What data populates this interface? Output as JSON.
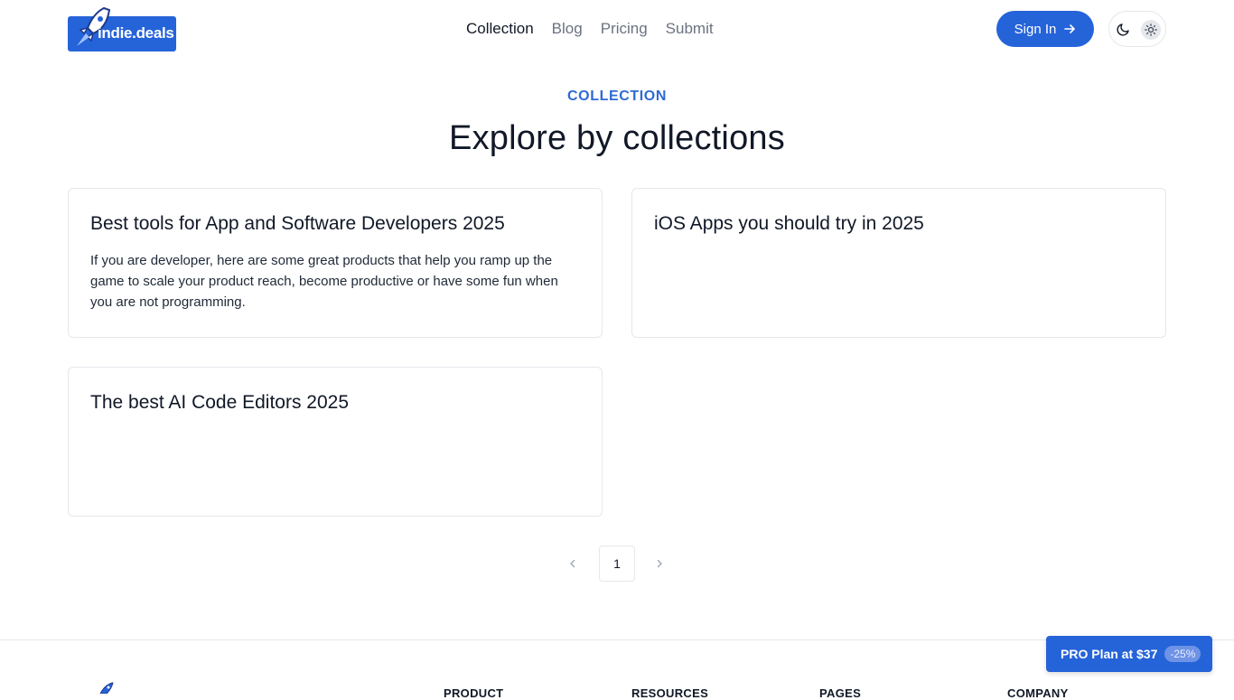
{
  "brand": {
    "name": "indie.deals",
    "color": "#2563d9"
  },
  "nav": {
    "items": [
      {
        "label": "Collection",
        "active": true
      },
      {
        "label": "Blog",
        "active": false
      },
      {
        "label": "Pricing",
        "active": false
      },
      {
        "label": "Submit",
        "active": false
      }
    ]
  },
  "header": {
    "signin_label": "Sign In",
    "signin_icon": "arrow-right-icon"
  },
  "theme": {
    "dark_icon": "moon-icon",
    "light_icon": "sun-icon",
    "selected": "light"
  },
  "hero": {
    "eyebrow": "COLLECTION",
    "title": "Explore by collections"
  },
  "collections": [
    {
      "title": "Best tools for App and Software Developers 2025",
      "description": "If you are developer, here are some great products that help you ramp up the game to scale your product reach, become productive or have some fun when you are not programming."
    },
    {
      "title": "iOS Apps you should try in 2025",
      "description": ""
    },
    {
      "title": "The best AI Code Editors 2025",
      "description": ""
    }
  ],
  "pagination": {
    "current": "1",
    "prev_icon": "chevron-left-icon",
    "next_icon": "chevron-right-icon"
  },
  "footer": {
    "columns": [
      "PRODUCT",
      "RESOURCES",
      "PAGES",
      "COMPANY"
    ]
  },
  "promo": {
    "label": "PRO Plan at $37",
    "badge": "-25%"
  }
}
